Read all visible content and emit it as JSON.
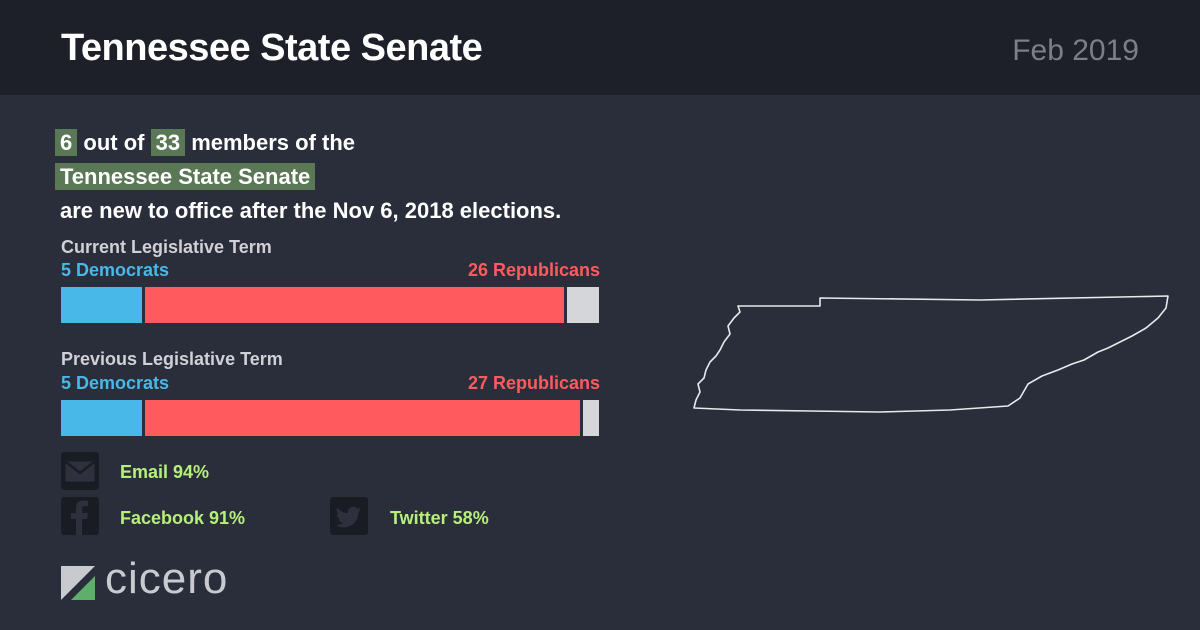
{
  "header": {
    "title": "Tennessee State Senate",
    "date": "Feb 2019"
  },
  "headline": {
    "new_count": "6",
    "out_of_text": "out of",
    "total_count": "33",
    "members_text": "members of the",
    "chamber": "Tennessee State Senate",
    "suffix": "are new to office after the Nov 6, 2018 elections."
  },
  "terms": [
    {
      "label": "Current Legislative Term",
      "dem_label": "5 Democrats",
      "rep_label": "26 Republicans",
      "democrats": 5,
      "republicans": 26,
      "other": 2,
      "total": 33
    },
    {
      "label": "Previous Legislative Term",
      "dem_label": "5 Democrats",
      "rep_label": "27 Republicans",
      "democrats": 5,
      "republicans": 27,
      "other": 1,
      "total": 33
    }
  ],
  "social": {
    "email": "Email 94%",
    "facebook": "Facebook 91%",
    "twitter": "Twitter 58%"
  },
  "logo": {
    "text": "cicero"
  },
  "colors": {
    "democrat": "#47b8e8",
    "republican": "#ff5b5e",
    "other": "#d5d6d9",
    "highlight": "#5a7856",
    "social_text": "#b5f07a"
  }
}
